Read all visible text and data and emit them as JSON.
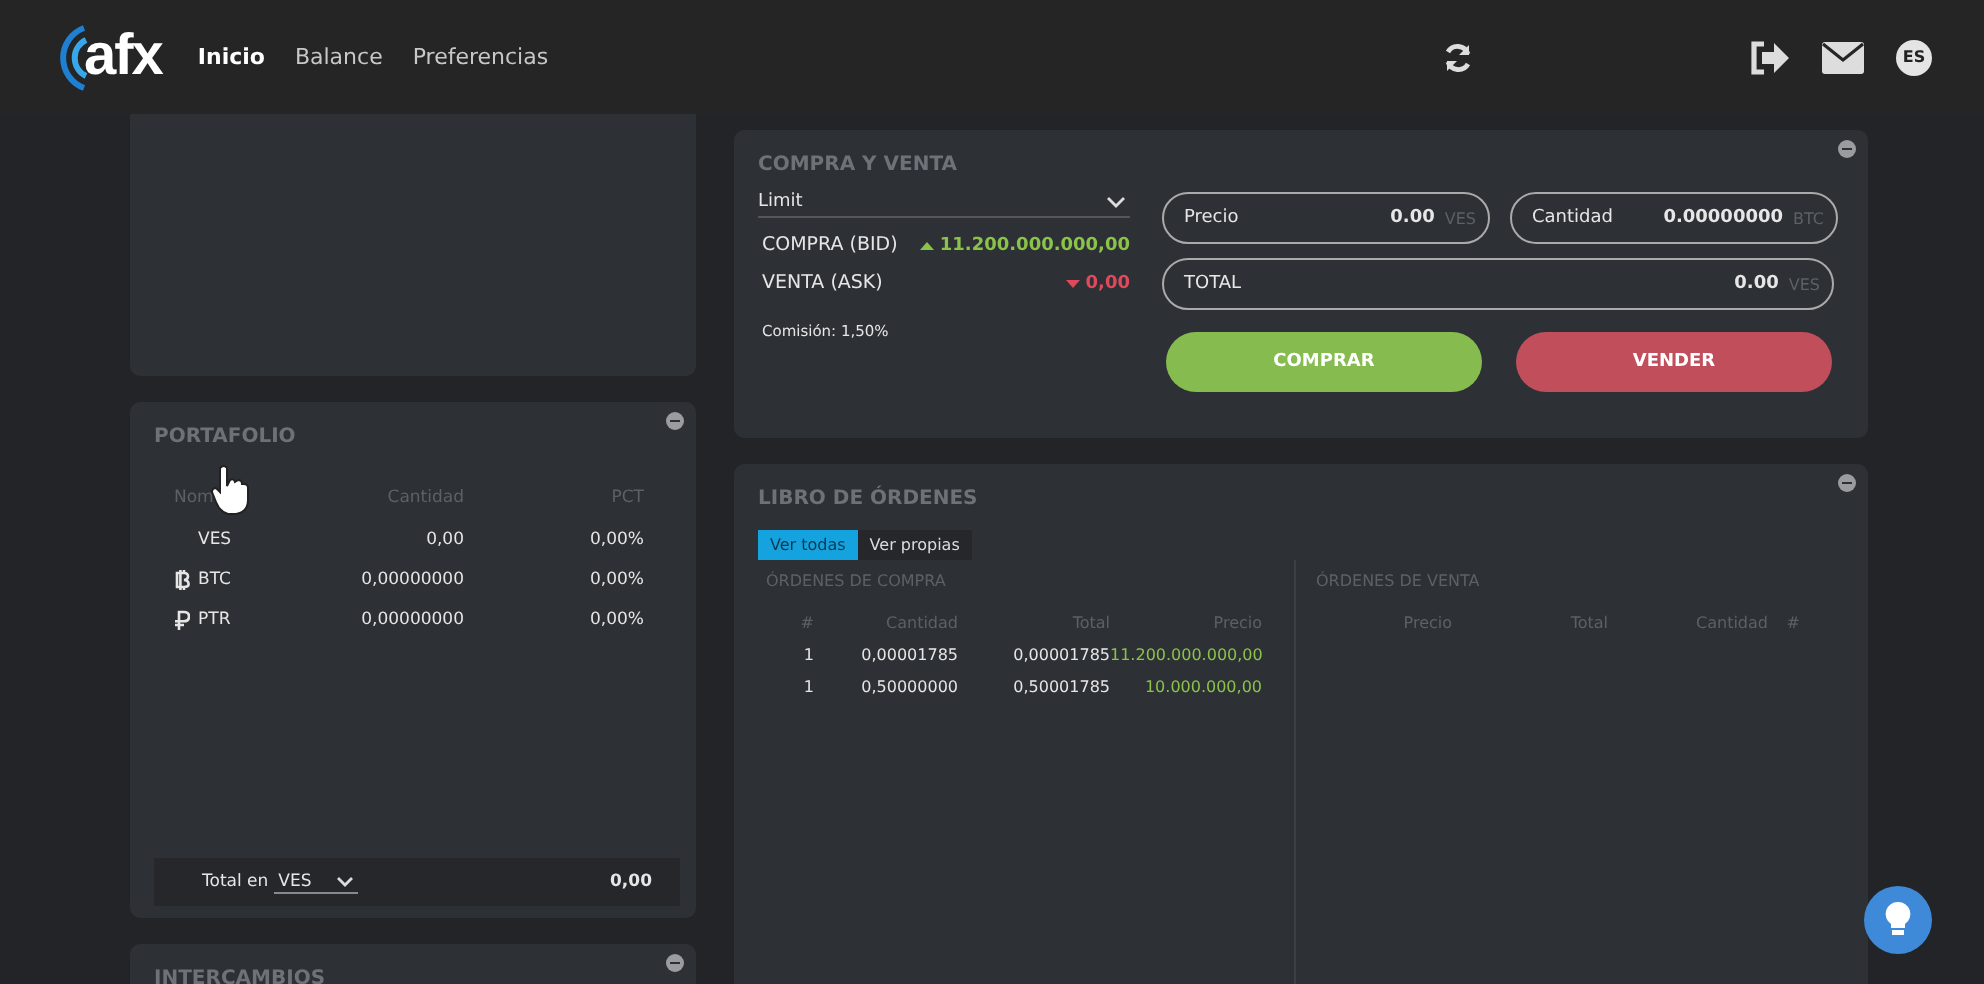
{
  "header": {
    "logo": "afx",
    "nav": [
      {
        "label": "Inicio",
        "selected": true
      },
      {
        "label": "Balance",
        "selected": false
      },
      {
        "label": "Preferencias",
        "selected": false
      }
    ],
    "language": "ES"
  },
  "portfolio": {
    "title": "PORTAFOLIO",
    "columns": [
      "Nom",
      "Cantidad",
      "PCT"
    ],
    "rows": [
      {
        "kind": "none",
        "symbol": "VES",
        "amount": "0,00",
        "pct": "0,00%"
      },
      {
        "kind": "btc",
        "symbol": "BTC",
        "amount": "0,00000000",
        "pct": "0,00%"
      },
      {
        "kind": "ptr",
        "symbol": "PTR",
        "amount": "0,00000000",
        "pct": "0,00%"
      }
    ],
    "total_label": "Total en",
    "total_currency": "VES",
    "total_value": "0,00"
  },
  "exchanges": {
    "title": "INTERCAMBIOS"
  },
  "trade": {
    "title": "COMPRA Y VENTA",
    "order_type": "Limit",
    "bid_label": "COMPRA (BID)",
    "bid_value": "11.200.000.000,00",
    "ask_label": "VENTA (ASK)",
    "ask_value": "0,00",
    "commission": "Comisión: 1,50%",
    "fields": [
      {
        "label": "Precio",
        "value": "0.00",
        "unit": "VES"
      },
      {
        "label": "Cantidad",
        "value": "0.00000000",
        "unit": "BTC"
      },
      {
        "label": "TOTAL",
        "value": "0.00",
        "unit": "VES"
      }
    ],
    "buy": "COMPRAR",
    "sell": "VENDER"
  },
  "orderbook": {
    "title": "LIBRO DE ÓRDENES",
    "tabs": [
      {
        "label": "Ver todas",
        "selected": true
      },
      {
        "label": "Ver propias",
        "selected": false
      }
    ],
    "buy_title": "ÓRDENES DE COMPRA",
    "buy_columns": [
      "#",
      "Cantidad",
      "Total",
      "Precio"
    ],
    "buy_rows": [
      [
        "1",
        "0,00001785",
        "0,00001785",
        "11.200.000.000,00"
      ],
      [
        "1",
        "0,50000000",
        "0,50001785",
        "10.000.000,00"
      ]
    ],
    "sell_title": "ÓRDENES DE VENTA",
    "sell_columns": [
      "Precio",
      "Total",
      "Cantidad",
      "#"
    ]
  }
}
